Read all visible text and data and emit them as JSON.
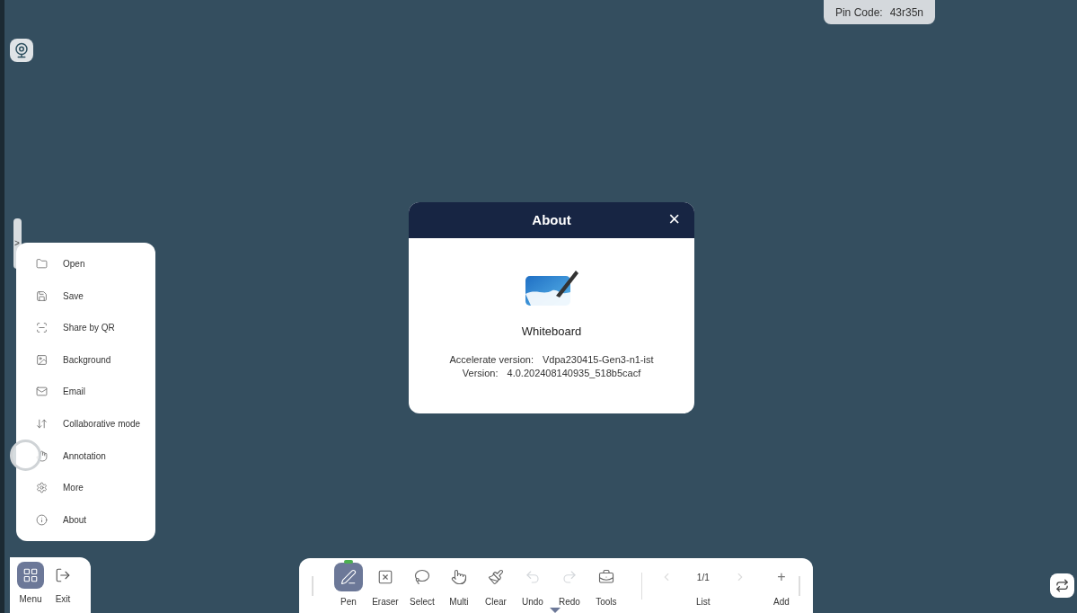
{
  "pin_code": {
    "label": "Pin Code:",
    "value": "43r35n"
  },
  "dialog": {
    "title": "About",
    "close": "×",
    "app_name": "Whiteboard",
    "details": [
      {
        "label": "Accelerate version:",
        "value": "Vdpa230415-Gen3-n1-ist"
      },
      {
        "label": "Version:",
        "value": "4.0.202408140935_518b5cacf"
      }
    ]
  },
  "side_handle": {
    "glyph": ">"
  },
  "menu": {
    "items": [
      {
        "label": "Open"
      },
      {
        "label": "Save"
      },
      {
        "label": "Share by QR"
      },
      {
        "label": "Background"
      },
      {
        "label": "Email"
      },
      {
        "label": "Collaborative mode"
      },
      {
        "label": "Annotation"
      },
      {
        "label": "More"
      },
      {
        "label": "About"
      }
    ]
  },
  "dock": [
    {
      "label": "Menu",
      "selected": true
    },
    {
      "label": "Exit",
      "selected": false
    }
  ],
  "toolbar": {
    "tools": [
      {
        "label": "Pen",
        "selected": true,
        "disabled": false
      },
      {
        "label": "Eraser",
        "selected": false,
        "disabled": false
      },
      {
        "label": "Select",
        "selected": false,
        "disabled": false
      },
      {
        "label": "Multi",
        "selected": false,
        "disabled": false
      },
      {
        "label": "Clear",
        "selected": false,
        "disabled": false
      },
      {
        "label": "Undo",
        "selected": false,
        "disabled": true
      },
      {
        "label": "Redo",
        "selected": false,
        "disabled": true
      },
      {
        "label": "Tools",
        "selected": false,
        "disabled": false
      }
    ],
    "pager": {
      "page": "1/1",
      "label": "List",
      "prev_disabled": true,
      "next_disabled": true
    },
    "add": {
      "glyph": "+",
      "label": "Add"
    }
  }
}
